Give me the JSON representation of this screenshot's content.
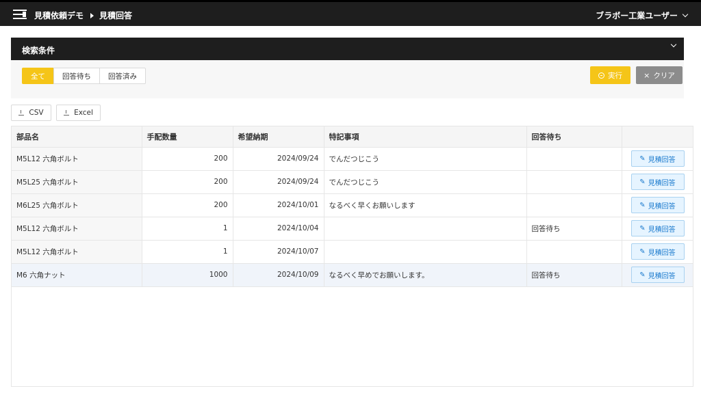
{
  "header": {
    "breadcrumb": [
      "見積依頼デモ",
      "見積回答"
    ],
    "user_name": "ブラボー工業ユーザー"
  },
  "search": {
    "title": "検索条件",
    "filters": [
      "全て",
      "回答待ち",
      "回答済み"
    ],
    "active_filter": "全て",
    "run_label": "実行",
    "clear_label": "クリア"
  },
  "downloads": {
    "csv_label": "CSV",
    "excel_label": "Excel"
  },
  "table": {
    "columns": [
      "部品名",
      "手配数量",
      "希望納期",
      "特記事項",
      "回答待ち",
      ""
    ],
    "rows": [
      {
        "part": "M5L12 六角ボルト",
        "qty": "200",
        "date": "2024/09/24",
        "note": "でんだつじこう",
        "status": "",
        "action": "見積回答"
      },
      {
        "part": "M5L25 六角ボルト",
        "qty": "200",
        "date": "2024/09/24",
        "note": "でんだつじこう",
        "status": "",
        "action": "見積回答"
      },
      {
        "part": "M6L25 六角ボルト",
        "qty": "200",
        "date": "2024/10/01",
        "note": "なるべく早くお願いします",
        "status": "",
        "action": "見積回答"
      },
      {
        "part": "M5L12 六角ボルト",
        "qty": "1",
        "date": "2024/10/04",
        "note": "",
        "status": "回答待ち",
        "action": "見積回答"
      },
      {
        "part": "M5L12 六角ボルト",
        "qty": "1",
        "date": "2024/10/07",
        "note": "",
        "status": "",
        "action": "見積回答"
      },
      {
        "part": "M6 六角ナット",
        "qty": "1000",
        "date": "2024/10/09",
        "note": "なるべく早めでお願いします。",
        "status": "回答待ち",
        "action": "見積回答"
      }
    ]
  },
  "colors": {
    "accent": "#f5c518",
    "header_bg": "#1e1e1e",
    "link": "#1677cc"
  }
}
